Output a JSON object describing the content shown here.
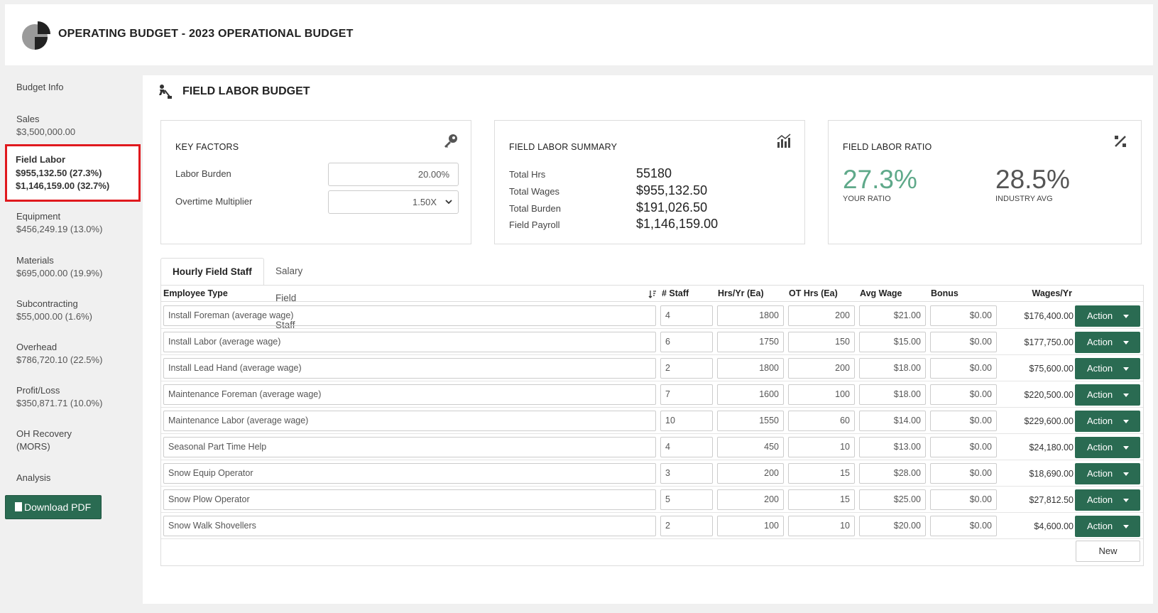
{
  "header": {
    "title": "OPERATING BUDGET - 2023 OPERATIONAL BUDGET"
  },
  "sidebar": {
    "items": [
      {
        "label": "Budget Info",
        "value": ""
      },
      {
        "label": "Sales",
        "value": "$3,500,000.00"
      },
      {
        "label": "Field Labor",
        "value": "$955,132.50 (27.3%)",
        "value2": "$1,146,159.00 (32.7%)"
      },
      {
        "label": "Equipment",
        "value": "$456,249.19 (13.0%)"
      },
      {
        "label": "Materials",
        "value": "$695,000.00 (19.9%)"
      },
      {
        "label": "Subcontracting",
        "value": "$55,000.00 (1.6%)"
      },
      {
        "label": "Overhead",
        "value": "$786,720.10 (22.5%)"
      },
      {
        "label": "Profit/Loss",
        "value": "$350,871.71 (10.0%)"
      },
      {
        "label": "OH Recovery",
        "value": "(MORS)"
      },
      {
        "label": "Analysis",
        "value": ""
      }
    ],
    "pdf_label": "Download PDF"
  },
  "main": {
    "title": "FIELD LABOR BUDGET",
    "key_factors": {
      "title": "KEY FACTORS",
      "labor_burden_label": "Labor Burden",
      "labor_burden_value": "20.00%",
      "ot_label": "Overtime Multiplier",
      "ot_value": "1.50X"
    },
    "summary": {
      "title": "FIELD LABOR SUMMARY",
      "rows": [
        {
          "label": "Total Hrs",
          "value": "55180"
        },
        {
          "label": "Total Wages",
          "value": "$955,132.50"
        },
        {
          "label": "Total Burden",
          "value": "$191,026.50"
        },
        {
          "label": "Field Payroll",
          "value": "$1,146,159.00"
        }
      ]
    },
    "ratio": {
      "title": "FIELD LABOR RATIO",
      "your_value": "27.3%",
      "your_label": "YOUR RATIO",
      "industry_value": "28.5%",
      "industry_label": "INDUSTRY AVG"
    },
    "tabs": [
      "Hourly Field Staff",
      "Salary Field Staff"
    ],
    "table": {
      "headers": [
        "Employee Type",
        "# Staff",
        "Hrs/Yr (Ea)",
        "OT Hrs (Ea)",
        "Avg Wage",
        "Bonus",
        "Wages/Yr"
      ],
      "rows": [
        [
          "Install Foreman (average wage)",
          "4",
          "1800",
          "200",
          "$21.00",
          "$0.00",
          "$176,400.00"
        ],
        [
          "Install Labor (average wage)",
          "6",
          "1750",
          "150",
          "$15.00",
          "$0.00",
          "$177,750.00"
        ],
        [
          "Install Lead Hand (average wage)",
          "2",
          "1800",
          "200",
          "$18.00",
          "$0.00",
          "$75,600.00"
        ],
        [
          "Maintenance Foreman (average wage)",
          "7",
          "1600",
          "100",
          "$18.00",
          "$0.00",
          "$220,500.00"
        ],
        [
          "Maintenance Labor (average wage)",
          "10",
          "1550",
          "60",
          "$14.00",
          "$0.00",
          "$229,600.00"
        ],
        [
          "Seasonal Part Time Help",
          "4",
          "450",
          "10",
          "$13.00",
          "$0.00",
          "$24,180.00"
        ],
        [
          "Snow Equip Operator",
          "3",
          "200",
          "15",
          "$28.00",
          "$0.00",
          "$18,690.00"
        ],
        [
          "Snow Plow Operator",
          "5",
          "200",
          "15",
          "$25.00",
          "$0.00",
          "$27,812.50"
        ],
        [
          "Snow Walk Shovellers",
          "2",
          "100",
          "10",
          "$20.00",
          "$0.00",
          "$4,600.00"
        ]
      ],
      "action_label": "Action",
      "new_label": "New"
    }
  },
  "colors": {
    "accent": "#2a6b52",
    "ratio_green": "#5fa98a",
    "highlight": "#e0191e"
  }
}
